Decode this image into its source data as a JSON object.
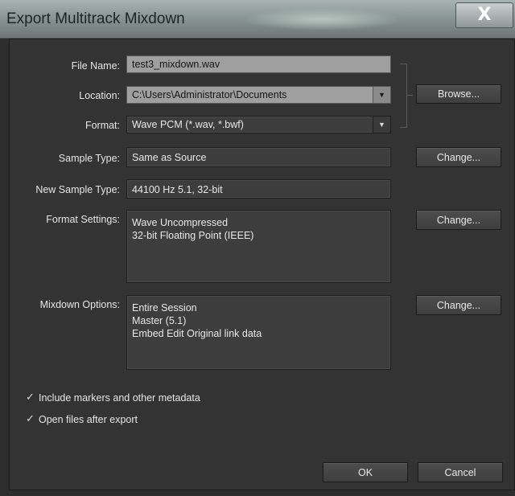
{
  "window": {
    "title": "Export Multitrack Mixdown"
  },
  "form": {
    "file_name_label": "File Name:",
    "file_name_value": "test3_mixdown.wav",
    "location_label": "Location:",
    "location_value": "C:\\Users\\Administrator\\Documents",
    "format_label": "Format:",
    "format_value": "Wave PCM (*.wav, *.bwf)",
    "sample_type_label": "Sample Type:",
    "sample_type_value": "Same as Source",
    "new_sample_type_label": "New Sample Type:",
    "new_sample_type_value": "44100 Hz 5.1, 32-bit",
    "format_settings_label": "Format Settings:",
    "format_settings_lines": [
      "Wave Uncompressed",
      "32-bit Floating Point (IEEE)"
    ],
    "mixdown_options_label": "Mixdown Options:",
    "mixdown_options_lines": [
      "Entire Session",
      "Master (5.1)",
      "Embed Edit Original link data"
    ]
  },
  "buttons": {
    "browse": "Browse...",
    "change_sample_type": "Change...",
    "change_format_settings": "Change...",
    "change_mixdown_options": "Change...",
    "ok": "OK",
    "cancel": "Cancel"
  },
  "checkboxes": [
    {
      "label": "Include markers and other metadata",
      "checked": true
    },
    {
      "label": "Open files after export",
      "checked": true
    }
  ],
  "icons": {
    "close": "close-icon",
    "dropdown": "chevron-down-icon",
    "check": "checkmark-icon"
  },
  "colors": {
    "titlebar": "#8a9694",
    "panel": "#333333",
    "field_highlight": "#9f9f9f"
  }
}
